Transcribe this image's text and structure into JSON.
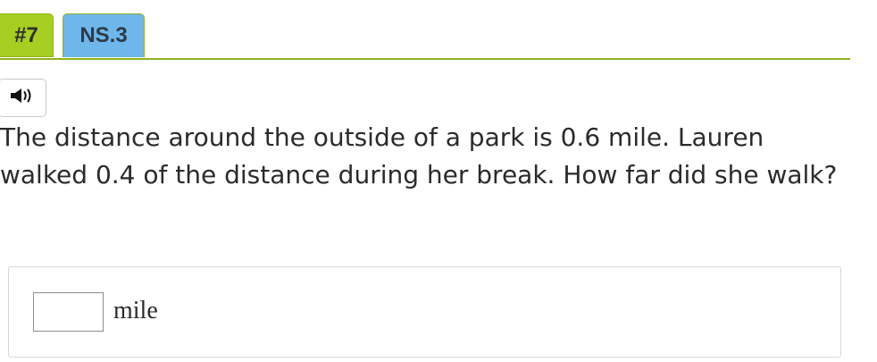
{
  "tabs": {
    "number": "#7",
    "standard": "NS.3"
  },
  "audio": {
    "icon": "speaker-icon"
  },
  "question": {
    "text": "The distance around the outside of a park is 0.6 mile. Lauren walked 0.4 of the distance during her break. How far did she walk?"
  },
  "answer": {
    "value": "",
    "unit": "mile"
  },
  "colors": {
    "tab_number_bg": "#a6cf21",
    "tab_standard_bg": "#6db7eb",
    "divider": "#8fb31e"
  }
}
